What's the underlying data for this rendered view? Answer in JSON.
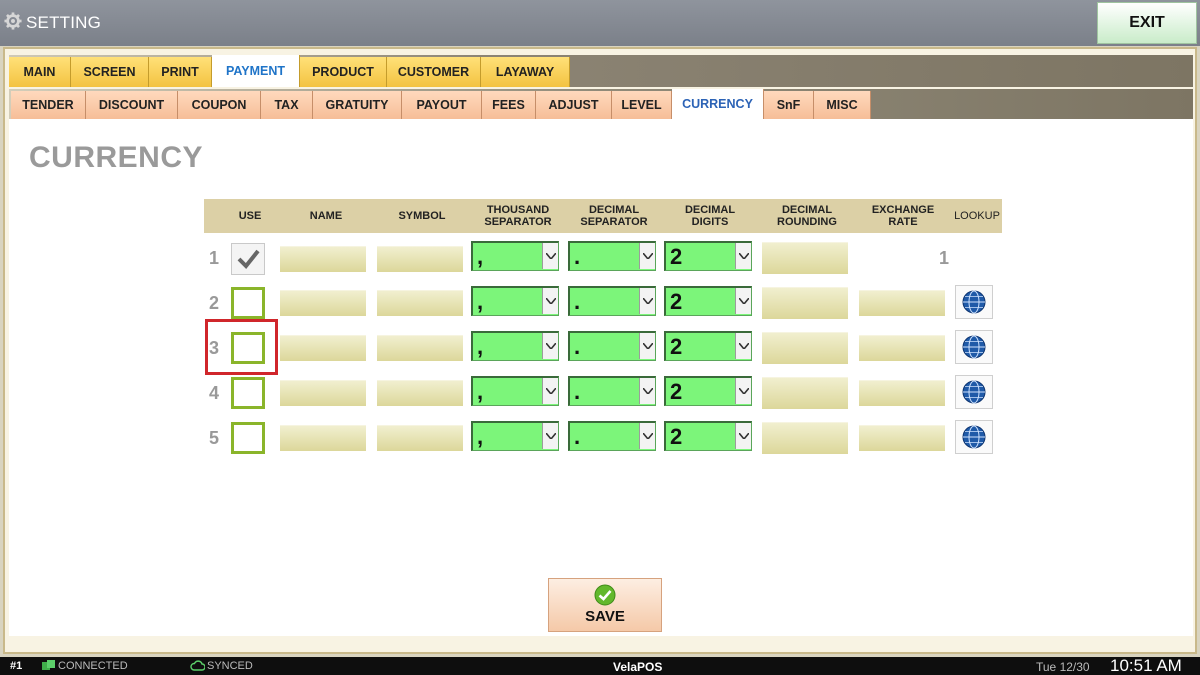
{
  "window": {
    "title": "SETTING",
    "exit_label": "EXIT"
  },
  "tabs_primary": [
    {
      "label": "MAIN"
    },
    {
      "label": "SCREEN"
    },
    {
      "label": "PRINT"
    },
    {
      "label": "PAYMENT"
    },
    {
      "label": "PRODUCT"
    },
    {
      "label": "CUSTOMER"
    },
    {
      "label": "LAYAWAY"
    }
  ],
  "tabs_primary_active": "PAYMENT",
  "tabs_secondary": [
    {
      "label": "TENDER"
    },
    {
      "label": "DISCOUNT"
    },
    {
      "label": "COUPON"
    },
    {
      "label": "TAX"
    },
    {
      "label": "GRATUITY"
    },
    {
      "label": "PAYOUT"
    },
    {
      "label": "FEES"
    },
    {
      "label": "ADJUST"
    },
    {
      "label": "LEVEL"
    },
    {
      "label": "CURRENCY"
    },
    {
      "label": "SnF"
    },
    {
      "label": "MISC"
    }
  ],
  "tabs_secondary_active": "CURRENCY",
  "page": {
    "heading": "CURRENCY"
  },
  "grid": {
    "headers": {
      "use": "USE",
      "name": "NAME",
      "symbol": "SYMBOL",
      "thousand_1": "THOUSAND",
      "thousand_2": "SEPARATOR",
      "decimal_sep_1": "DECIMAL",
      "decimal_sep_2": "SEPARATOR",
      "decimal_digits_1": "DECIMAL",
      "decimal_digits_2": "DIGITS",
      "decimal_rounding_1": "DECIMAL",
      "decimal_rounding_2": "ROUNDING",
      "exchange_1": "EXCHANGE",
      "exchange_2": "RATE",
      "lookup": "LOOKUP"
    },
    "rows": [
      {
        "num": "1",
        "use": true,
        "thousand": ",",
        "decimal": ".",
        "digits": "2",
        "exchange_rate": "1"
      },
      {
        "num": "2",
        "use": false,
        "thousand": ",",
        "decimal": ".",
        "digits": "2",
        "exchange_rate": ""
      },
      {
        "num": "3",
        "use": false,
        "thousand": ",",
        "decimal": ".",
        "digits": "2",
        "exchange_rate": ""
      },
      {
        "num": "4",
        "use": false,
        "thousand": ",",
        "decimal": ".",
        "digits": "2",
        "exchange_rate": ""
      },
      {
        "num": "5",
        "use": false,
        "thousand": ",",
        "decimal": ".",
        "digits": "2",
        "exchange_rate": ""
      }
    ]
  },
  "save_label": "SAVE",
  "status": {
    "terminal": "#1",
    "connection": "CONNECTED",
    "sync": "SYNCED",
    "brand": "VelaPOS",
    "date": "Tue 12/30",
    "time": "10:51 AM"
  },
  "colors": {
    "checkbox_border": "#8ab52a",
    "select_bg": "#7cf57a",
    "highlight": "#d0262b",
    "exit_bg": "#c9ecc9"
  }
}
